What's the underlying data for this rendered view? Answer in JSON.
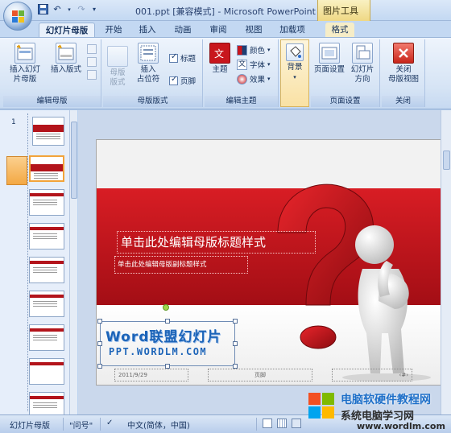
{
  "window": {
    "title": "001.ppt [兼容模式] - Microsoft PowerPoint",
    "context_tab_group": "图片工具"
  },
  "tabs": [
    {
      "label": "幻灯片母版",
      "active": true
    },
    {
      "label": "开始"
    },
    {
      "label": "插入"
    },
    {
      "label": "动画"
    },
    {
      "label": "审阅"
    },
    {
      "label": "视图"
    },
    {
      "label": "加载项"
    },
    {
      "label": "格式"
    }
  ],
  "ribbon": {
    "edit_master": {
      "label": "编辑母版",
      "insert_slide_master_line1": "插入幻灯",
      "insert_slide_master_line2": "片母版",
      "insert_layout": "插入版式"
    },
    "master_layout": {
      "label": "母版版式",
      "master_layout_line1": "母版",
      "master_layout_line2": "版式",
      "insert_placeholder_line1": "插入",
      "insert_placeholder_line2": "占位符",
      "title_check": "标题",
      "footer_check": "页脚"
    },
    "edit_theme": {
      "label": "编辑主题",
      "themes": "主题",
      "colors": "颜色",
      "fonts": "字体",
      "effects": "效果"
    },
    "background": {
      "label": "背景"
    },
    "page_setup": {
      "label": "页面设置",
      "page_setup_btn": "页面设置",
      "orientation_line1": "幻灯片",
      "orientation_line2": "方向"
    },
    "close": {
      "label": "关闭",
      "close_line1": "关闭",
      "close_line2": "母版视图"
    }
  },
  "thumbnail_pane": {
    "slide_number": "1"
  },
  "slide": {
    "title_placeholder": "单击此处编辑母版标题样式",
    "subtitle_placeholder": "单击此处编辑母版副标题样式",
    "logo_line1": "Word联盟幻灯片",
    "logo_line2": "PPT.WORDLM.COM",
    "footer_date": "2011/9/29",
    "footer_center": "页脚",
    "footer_number": "‹#›"
  },
  "statusbar": {
    "view": "幻灯片母版",
    "theme": "\"问号\"",
    "language": "中文(简体，中国)"
  },
  "watermark": {
    "line1": "电脑软硬件教程网",
    "line2": "系统电脑学习网",
    "line3": "www.wordlm.com"
  },
  "colors": {
    "accent_red": "#c8161d",
    "ribbon_blue": "#c3d8f2",
    "selected_thumb": "#f2a33a"
  }
}
